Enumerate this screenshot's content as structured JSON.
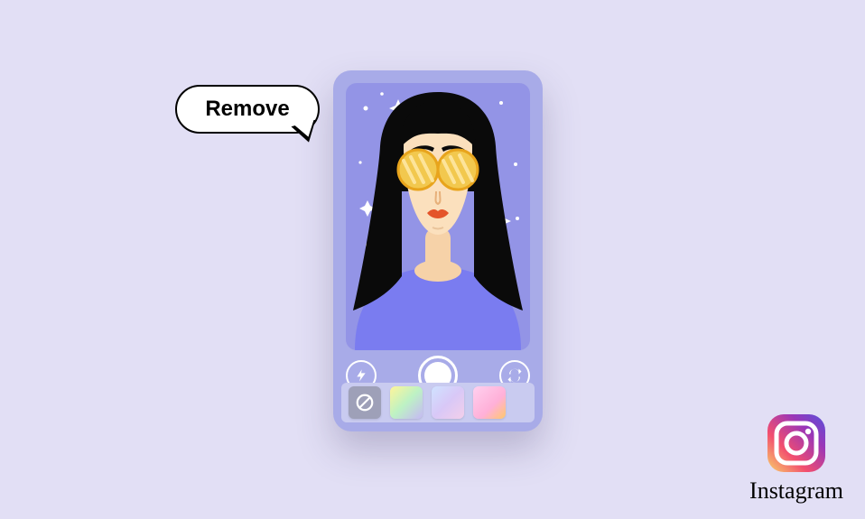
{
  "speech_bubble": {
    "label": "Remove"
  },
  "camera": {
    "controls": {
      "flash": "flash",
      "shutter": "shutter",
      "switch": "switch-camera"
    },
    "filters": {
      "none": "no-filter",
      "presets": [
        "gradient-yellow-green",
        "gradient-blue-lilac",
        "gradient-pink-orange"
      ]
    }
  },
  "brand": {
    "name": "Instagram"
  },
  "colors": {
    "page_bg": "#e2dff5",
    "card_bg": "#a8abe8",
    "viewfinder_bg": "#9394e6",
    "tray_bg": "#c9cbf0",
    "ig_gradient": [
      "#f9d36a",
      "#f24e6f",
      "#9b36b7",
      "#5851db"
    ]
  }
}
